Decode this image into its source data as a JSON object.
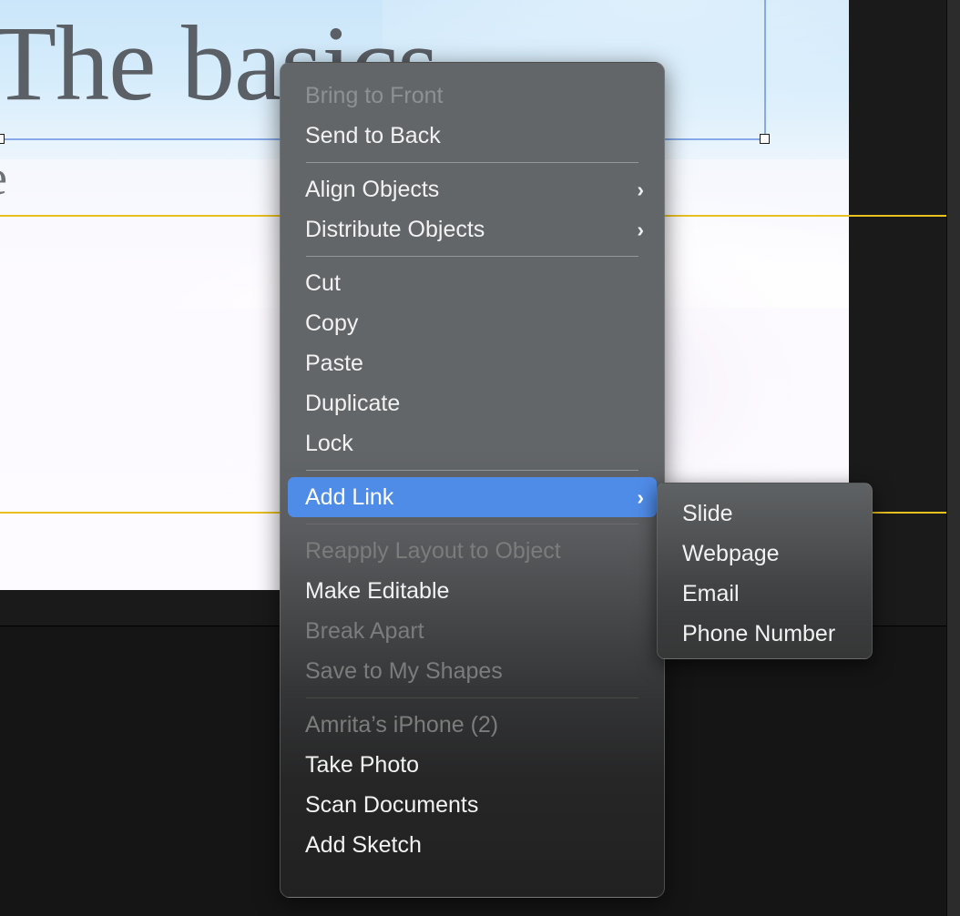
{
  "slide": {
    "title": "The basics",
    "subtitle": "e"
  },
  "context_menu": {
    "groups": [
      {
        "items": [
          {
            "label": "Bring to Front",
            "state": "disabled",
            "submenu": false
          },
          {
            "label": "Send to Back",
            "state": "enabled",
            "submenu": false
          }
        ]
      },
      {
        "items": [
          {
            "label": "Align Objects",
            "state": "enabled",
            "submenu": true
          },
          {
            "label": "Distribute Objects",
            "state": "enabled",
            "submenu": true
          }
        ]
      },
      {
        "items": [
          {
            "label": "Cut",
            "state": "enabled",
            "submenu": false
          },
          {
            "label": "Copy",
            "state": "enabled",
            "submenu": false
          },
          {
            "label": "Paste",
            "state": "enabled",
            "submenu": false
          },
          {
            "label": "Duplicate",
            "state": "enabled",
            "submenu": false
          },
          {
            "label": "Lock",
            "state": "enabled",
            "submenu": false
          }
        ]
      },
      {
        "items": [
          {
            "label": "Add Link",
            "state": "highlighted",
            "submenu": true
          }
        ]
      },
      {
        "items": [
          {
            "label": "Reapply Layout to Object",
            "state": "disabled",
            "submenu": false
          },
          {
            "label": "Make Editable",
            "state": "enabled",
            "submenu": false
          },
          {
            "label": "Break Apart",
            "state": "disabled",
            "submenu": false
          },
          {
            "label": "Save to My Shapes",
            "state": "disabled",
            "submenu": false
          }
        ]
      },
      {
        "items": [
          {
            "label": "Amrita’s iPhone (2)",
            "state": "section-header",
            "submenu": false
          },
          {
            "label": "Take Photo",
            "state": "enabled",
            "submenu": false
          },
          {
            "label": "Scan Documents",
            "state": "enabled",
            "submenu": false
          },
          {
            "label": "Add Sketch",
            "state": "enabled",
            "submenu": false
          }
        ]
      }
    ]
  },
  "submenu": {
    "parent": "Add Link",
    "items": [
      {
        "label": "Slide"
      },
      {
        "label": "Webpage"
      },
      {
        "label": "Email"
      },
      {
        "label": "Phone Number"
      }
    ]
  },
  "icons": {
    "chevron_right": "›"
  },
  "colors": {
    "menu_highlight": "#4f8ce8",
    "menu_text": "#f2f2f2",
    "menu_text_disabled": "#8e9094",
    "guide_blue": "#86a9e8",
    "guide_yellow": "#e8c020",
    "slide_sky": "#cbe6fa",
    "slide_background": "#fdfbff",
    "canvas_background": "#1a1a1a",
    "panel_background": "#2c2c2c"
  }
}
